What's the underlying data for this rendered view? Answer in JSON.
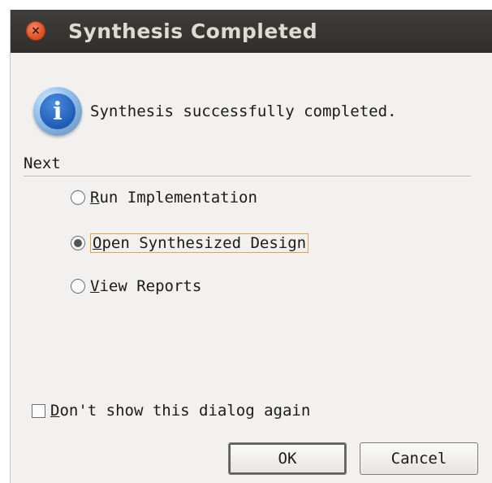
{
  "window": {
    "title": "Synthesis Completed",
    "close_icon": "×"
  },
  "message": {
    "icon": "info-icon",
    "icon_glyph": "i",
    "text": "Synthesis successfully completed."
  },
  "next": {
    "label": "Next",
    "options": [
      {
        "mnemonic": "R",
        "rest": "un Implementation",
        "selected": false
      },
      {
        "mnemonic": "O",
        "rest": "pen Synthesized Design",
        "selected": true
      },
      {
        "mnemonic": "V",
        "rest": "iew Reports",
        "selected": false
      }
    ]
  },
  "dont_show": {
    "mnemonic": "D",
    "rest": "on't show this dialog again",
    "checked": false
  },
  "buttons": {
    "ok": "OK",
    "cancel": "Cancel"
  }
}
